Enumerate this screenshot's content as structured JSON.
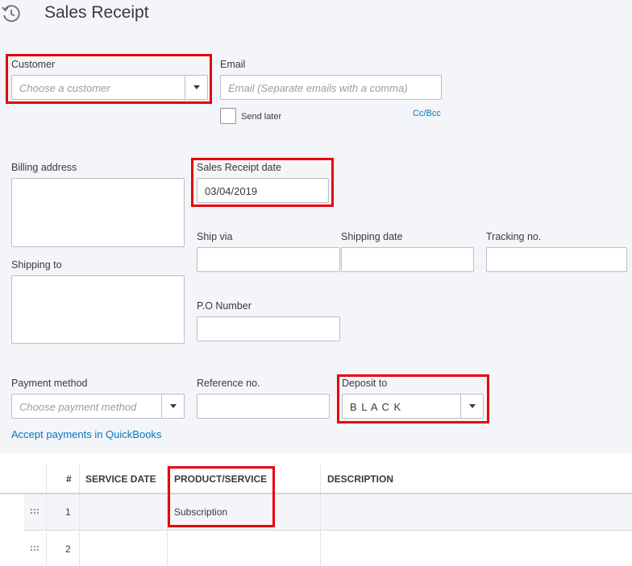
{
  "page": {
    "title": "Sales Receipt"
  },
  "customer": {
    "label": "Customer",
    "placeholder": "Choose a customer"
  },
  "email": {
    "label": "Email",
    "placeholder": "Email (Separate emails with a comma)",
    "send_later_label": "Send later",
    "cc_bcc_link": "Cc/Bcc"
  },
  "billing_address": {
    "label": "Billing address"
  },
  "sales_receipt_date": {
    "label": "Sales Receipt date",
    "value": "03/04/2019"
  },
  "ship_via": {
    "label": "Ship via"
  },
  "shipping_date": {
    "label": "Shipping date"
  },
  "tracking_no": {
    "label": "Tracking no."
  },
  "shipping_to": {
    "label": "Shipping to"
  },
  "po_number": {
    "label": "P.O Number"
  },
  "payment_method": {
    "label": "Payment method",
    "placeholder": "Choose payment method"
  },
  "reference_no": {
    "label": "Reference no."
  },
  "deposit_to": {
    "label": "Deposit to",
    "value": "B L A C K"
  },
  "accept_payments_link": "Accept payments in QuickBooks",
  "table": {
    "headers": {
      "number": "#",
      "service_date": "SERVICE DATE",
      "product_service": "PRODUCT/SERVICE",
      "description": "DESCRIPTION"
    },
    "rows": [
      {
        "number": "1",
        "product_service": "Subscription"
      },
      {
        "number": "2",
        "product_service": ""
      }
    ]
  },
  "colors": {
    "highlight": "#e8000b",
    "link": "#0077c5"
  },
  "icons": {
    "history": "history-icon",
    "dropdown": "chevron-down-icon",
    "drag": "drag-handle-icon"
  }
}
